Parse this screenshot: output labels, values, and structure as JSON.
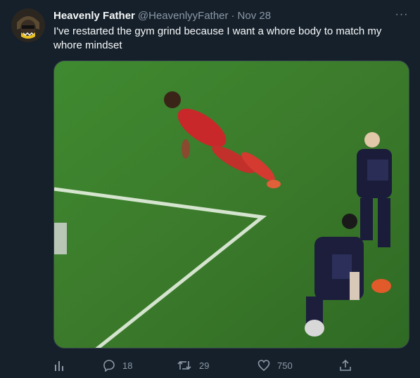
{
  "tweet": {
    "author_name": "Heavenly Father",
    "author_handle": "@HeavenlyyFather",
    "separator": "·",
    "date": "Nov 28",
    "text": "I've restarted the gym grind because I want a whore body to match my whore mindset",
    "more_label": "···"
  },
  "actions": {
    "replies": "18",
    "retweets": "29",
    "likes": "750"
  },
  "colors": {
    "background": "#15202b",
    "primary_text": "#f7f9f9",
    "secondary_text": "#8b98a5",
    "pitch": "#3d7d2c"
  },
  "icons": [
    "analytics-icon",
    "reply-icon",
    "retweet-icon",
    "like-icon",
    "share-icon",
    "more-icon"
  ]
}
